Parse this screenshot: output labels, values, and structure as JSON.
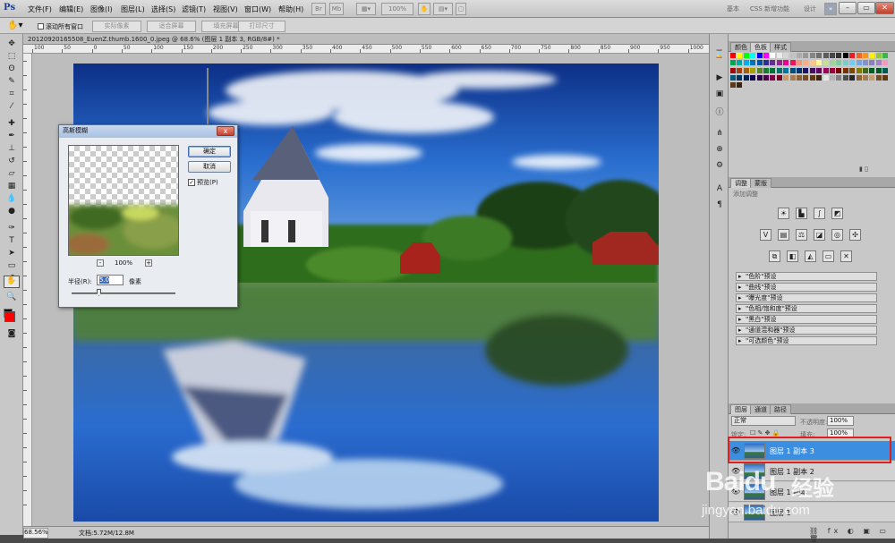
{
  "menubar": {
    "logo": "Ps",
    "items": [
      "文件(F)",
      "编辑(E)",
      "图像(I)",
      "图层(L)",
      "选择(S)",
      "滤镜(T)",
      "视图(V)",
      "窗口(W)",
      "帮助(H)"
    ],
    "zoom_value": "100%",
    "workspaces": [
      "基本",
      "CSS 新增功能",
      "设计"
    ],
    "chevron": "»"
  },
  "options": {
    "scroll_all_label": "滚动所有窗口",
    "buttons": [
      "实际像素",
      "适合屏幕",
      "填充屏幕",
      "打印尺寸"
    ]
  },
  "document": {
    "tab_title": "20120920165508_EuenZ.thumb.1600_0.jpeg @ 68.6% (图层 1 副本 3, RGB/8#) *",
    "zoom": "68.56%",
    "doc_info": "文档:5.72M/12.8M"
  },
  "ruler": {
    "h_numbers": [
      "100",
      "50",
      "0",
      "50",
      "100",
      "150",
      "200",
      "250",
      "300",
      "350",
      "400",
      "450",
      "500",
      "550",
      "600",
      "650",
      "700",
      "750",
      "800",
      "850",
      "900",
      "950",
      "1000"
    ]
  },
  "dialog": {
    "title": "高斯模糊",
    "ok": "确定",
    "cancel": "取消",
    "preview_label": "预览(P)",
    "preview_checked": "✓",
    "zoom_pct": "100%",
    "zoom_minus": "-",
    "zoom_plus": "+",
    "radius_label": "半径(R):",
    "radius_value": "5.0",
    "radius_unit": "像素",
    "close": "x"
  },
  "panels": {
    "color_tabs": [
      "颜色",
      "色板",
      "样式"
    ],
    "adjust_tabs": [
      "调整",
      "蒙版"
    ],
    "adjust_hint": "添加调整",
    "presets": [
      "\"色阶\"预设",
      "\"曲线\"预设",
      "\"曝光度\"预设",
      "\"色相/饱和度\"预设",
      "\"黑白\"预设",
      "\"通道混和器\"预设",
      "\"可选颜色\"预设"
    ],
    "layer_tabs": [
      "图层",
      "通道",
      "路径"
    ],
    "blend_mode": "正常",
    "opacity_label": "不透明度:",
    "opacity": "100%",
    "lock_label": "锁定:",
    "fill_label": "填充:",
    "fill": "100%",
    "layers": [
      {
        "name": "图层 1 副本 3",
        "selected": true
      },
      {
        "name": "图层 1 副本 2",
        "selected": false
      },
      {
        "name": "图层 1 副本",
        "selected": false
      },
      {
        "name": "图层 1",
        "selected": false
      }
    ]
  },
  "watermark": {
    "brand": "Baidu",
    "suffix": "经验",
    "url": "jingyan.baidu.com"
  },
  "colors": {
    "selected_layer": "#3b8ee0",
    "highlight": "#e01f1f",
    "foreground": "#ff0000"
  }
}
